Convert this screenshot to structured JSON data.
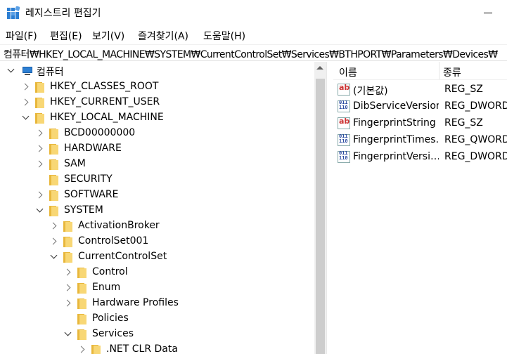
{
  "window": {
    "title": "레지스트리 편집기"
  },
  "menu": [
    {
      "label": "파일(F)"
    },
    {
      "label": "편집(E)"
    },
    {
      "label": "보기(V)"
    },
    {
      "label": "즐겨찾기(A)"
    },
    {
      "label": "도움말(H)"
    }
  ],
  "address": {
    "path": "컴퓨터₩HKEY_LOCAL_MACHINE₩SYSTEM₩CurrentControlSet₩Services₩BTHPORT₩Parameters₩Devices₩"
  },
  "tree": {
    "items": [
      {
        "label": "컴퓨터",
        "icon": "computer-icon",
        "expanded": true
      },
      {
        "label": "HKEY_CLASSES_ROOT",
        "icon": "folder-icon",
        "expanded": false
      },
      {
        "label": "HKEY_CURRENT_USER",
        "icon": "folder-icon",
        "expanded": false
      },
      {
        "label": "HKEY_LOCAL_MACHINE",
        "icon": "folder-icon",
        "expanded": true
      },
      {
        "label": "BCD00000000",
        "icon": "folder-icon",
        "expanded": false
      },
      {
        "label": "HARDWARE",
        "icon": "folder-icon",
        "expanded": false
      },
      {
        "label": "SAM",
        "icon": "folder-icon",
        "expanded": false
      },
      {
        "label": "SECURITY",
        "icon": "folder-icon",
        "expanded": null
      },
      {
        "label": "SOFTWARE",
        "icon": "folder-icon",
        "expanded": false
      },
      {
        "label": "SYSTEM",
        "icon": "folder-icon",
        "expanded": true
      },
      {
        "label": "ActivationBroker",
        "icon": "folder-icon",
        "expanded": false
      },
      {
        "label": "ControlSet001",
        "icon": "folder-icon",
        "expanded": false
      },
      {
        "label": "CurrentControlSet",
        "icon": "folder-icon",
        "expanded": true
      },
      {
        "label": "Control",
        "icon": "folder-icon",
        "expanded": false
      },
      {
        "label": "Enum",
        "icon": "folder-icon",
        "expanded": false
      },
      {
        "label": "Hardware Profiles",
        "icon": "folder-icon",
        "expanded": false
      },
      {
        "label": "Policies",
        "icon": "folder-icon",
        "expanded": null
      },
      {
        "label": "Services",
        "icon": "folder-icon",
        "expanded": true
      },
      {
        "label": ".NET CLR Data",
        "icon": "folder-icon",
        "expanded": false
      }
    ]
  },
  "values": {
    "headers": {
      "name": "이름",
      "type": "종류"
    },
    "rows": [
      {
        "name": "(기본값)",
        "type": "REG_SZ",
        "icon": "string-value-icon"
      },
      {
        "name": "DibServiceVersion",
        "type": "REG_DWORD",
        "icon": "binary-value-icon"
      },
      {
        "name": "FingerprintString",
        "type": "REG_SZ",
        "icon": "string-value-icon"
      },
      {
        "name": "FingerprintTimes…",
        "type": "REG_QWORD",
        "icon": "binary-value-icon"
      },
      {
        "name": "FingerprintVersi…",
        "type": "REG_DWORD",
        "icon": "binary-value-icon"
      }
    ]
  },
  "colors": {
    "folder": "#f8d775",
    "folder_edge": "#e8b73c",
    "computer": "#2d7fd3",
    "string_icon": "#cc3333",
    "binary_icon": "#2a4aa0"
  }
}
